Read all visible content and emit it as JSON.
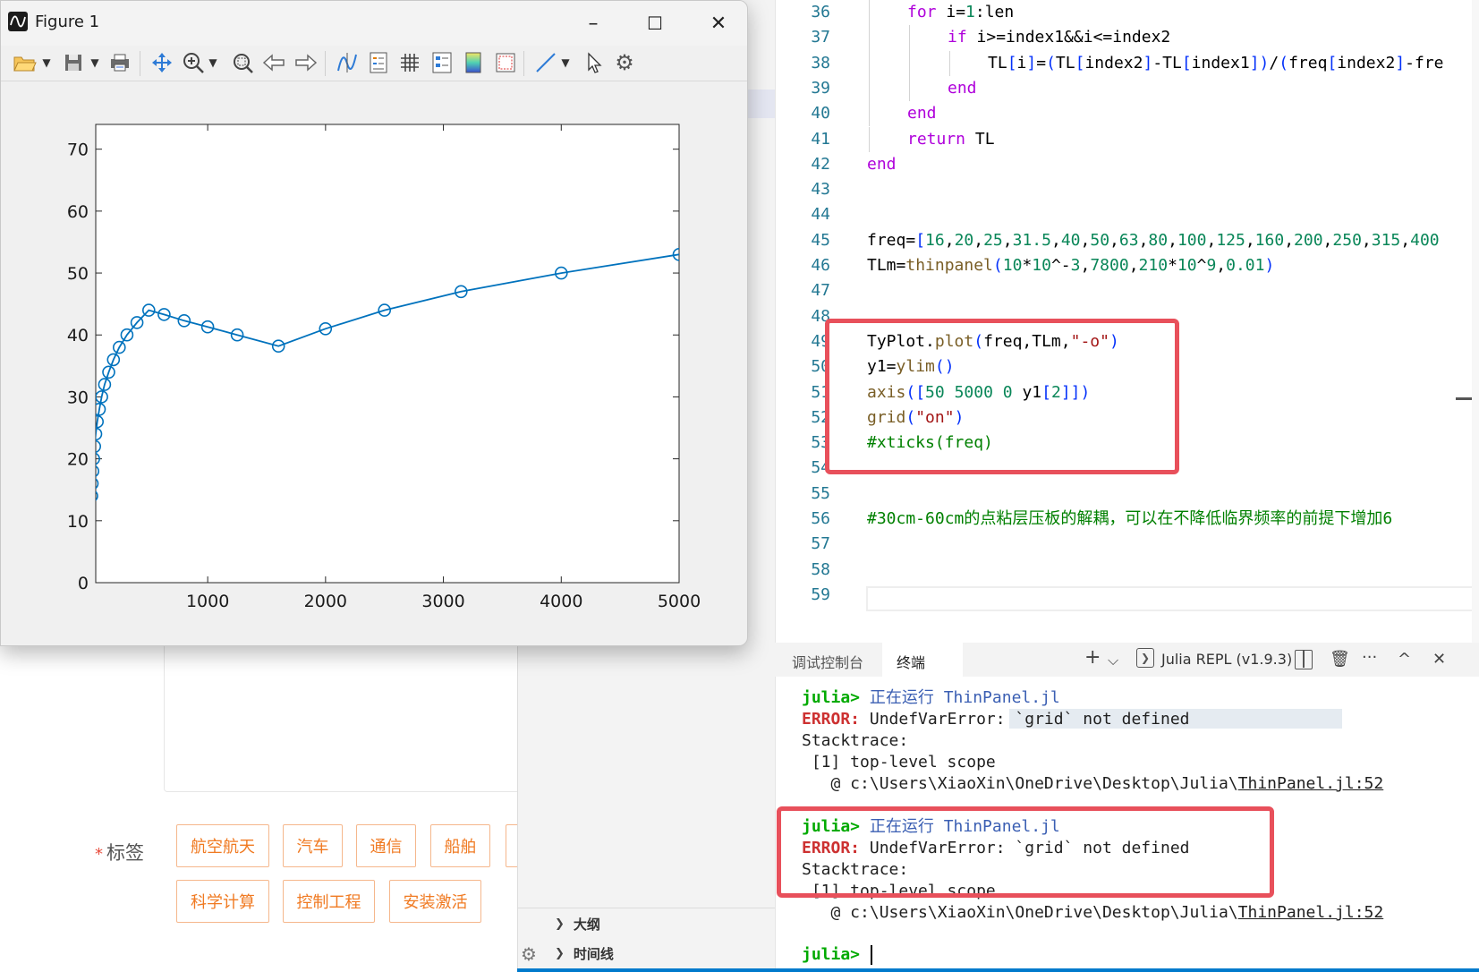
{
  "figure": {
    "title": "Figure 1",
    "window_controls": {
      "minimize": "–",
      "maximize": "☐",
      "close": "✕"
    },
    "chart_data": {
      "type": "line",
      "x": [
        16,
        20,
        25,
        31.5,
        40,
        50,
        63,
        80,
        100,
        125,
        160,
        200,
        250,
        315,
        400,
        500,
        630,
        800,
        1000,
        1250,
        1600,
        2000,
        2500,
        3150,
        4000,
        5000
      ],
      "series": [
        {
          "values": [
            14,
            16,
            18,
            20,
            22,
            24,
            26,
            28,
            30,
            32,
            34,
            36,
            38,
            40,
            42,
            44,
            43.3,
            42.3,
            41.3,
            40,
            38.2,
            41,
            44,
            47,
            50,
            53
          ],
          "marker": "o",
          "color": "#0072bd"
        }
      ],
      "xlim": [
        50,
        5000
      ],
      "ylim": [
        0,
        74
      ],
      "xticks": [
        1000,
        2000,
        3000,
        4000,
        5000
      ],
      "yticks": [
        0,
        10,
        20,
        30,
        40,
        50,
        60,
        70
      ],
      "grid": false,
      "title": "",
      "xlabel": "",
      "ylabel": ""
    }
  },
  "editor": {
    "lines": [
      {
        "n": "36",
        "indent": 2,
        "tokens": [
          [
            "kw",
            "for"
          ],
          [
            "plain",
            " i="
          ],
          [
            "num",
            "1"
          ],
          [
            "plain",
            ":len"
          ]
        ]
      },
      {
        "n": "37",
        "indent": 3,
        "tokens": [
          [
            "kw",
            "if"
          ],
          [
            "plain",
            " i>=index1&&i<=index2"
          ]
        ]
      },
      {
        "n": "38",
        "indent": 4,
        "tokens": [
          [
            "plain",
            "TL"
          ],
          [
            "pun",
            "["
          ],
          [
            "plain",
            "i"
          ],
          [
            "pun",
            "]"
          ],
          [
            "plain",
            "="
          ],
          [
            "pun",
            "("
          ],
          [
            "plain",
            "TL"
          ],
          [
            "pun",
            "["
          ],
          [
            "plain",
            "index2"
          ],
          [
            "pun",
            "]"
          ],
          [
            "plain",
            "-TL"
          ],
          [
            "pun",
            "["
          ],
          [
            "plain",
            "index1"
          ],
          [
            "pun",
            "])"
          ],
          [
            "plain",
            "/"
          ],
          [
            "pun",
            "("
          ],
          [
            "plain",
            "freq"
          ],
          [
            "pun",
            "["
          ],
          [
            "plain",
            "index2"
          ],
          [
            "pun",
            "]"
          ],
          [
            "plain",
            "-fre"
          ]
        ]
      },
      {
        "n": "39",
        "indent": 3,
        "tokens": [
          [
            "kw",
            "end"
          ]
        ]
      },
      {
        "n": "40",
        "indent": 2,
        "tokens": [
          [
            "kw",
            "end"
          ]
        ]
      },
      {
        "n": "41",
        "indent": 2,
        "tokens": [
          [
            "kw",
            "return"
          ],
          [
            "plain",
            " TL"
          ]
        ]
      },
      {
        "n": "42",
        "indent": 1,
        "tokens": [
          [
            "kw",
            "end"
          ]
        ]
      },
      {
        "n": "43",
        "indent": 1,
        "tokens": []
      },
      {
        "n": "44",
        "indent": 1,
        "tokens": []
      },
      {
        "n": "45",
        "indent": 1,
        "tokens": [
          [
            "plain",
            "freq="
          ],
          [
            "pun",
            "["
          ],
          [
            "num",
            "16"
          ],
          [
            "plain",
            ","
          ],
          [
            "num",
            "20"
          ],
          [
            "plain",
            ","
          ],
          [
            "num",
            "25"
          ],
          [
            "plain",
            ","
          ],
          [
            "num",
            "31.5"
          ],
          [
            "plain",
            ","
          ],
          [
            "num",
            "40"
          ],
          [
            "plain",
            ","
          ],
          [
            "num",
            "50"
          ],
          [
            "plain",
            ","
          ],
          [
            "num",
            "63"
          ],
          [
            "plain",
            ","
          ],
          [
            "num",
            "80"
          ],
          [
            "plain",
            ","
          ],
          [
            "num",
            "100"
          ],
          [
            "plain",
            ","
          ],
          [
            "num",
            "125"
          ],
          [
            "plain",
            ","
          ],
          [
            "num",
            "160"
          ],
          [
            "plain",
            ","
          ],
          [
            "num",
            "200"
          ],
          [
            "plain",
            ","
          ],
          [
            "num",
            "250"
          ],
          [
            "plain",
            ","
          ],
          [
            "num",
            "315"
          ],
          [
            "plain",
            ","
          ],
          [
            "num",
            "400"
          ]
        ]
      },
      {
        "n": "46",
        "indent": 1,
        "tokens": [
          [
            "plain",
            "TLm="
          ],
          [
            "fn",
            "thinpanel"
          ],
          [
            "pun",
            "("
          ],
          [
            "num",
            "10"
          ],
          [
            "plain",
            "*"
          ],
          [
            "num",
            "10"
          ],
          [
            "plain",
            "^-"
          ],
          [
            "num",
            "3"
          ],
          [
            "plain",
            ","
          ],
          [
            "num",
            "7800"
          ],
          [
            "plain",
            ","
          ],
          [
            "num",
            "210"
          ],
          [
            "plain",
            "*"
          ],
          [
            "num",
            "10"
          ],
          [
            "plain",
            "^"
          ],
          [
            "num",
            "9"
          ],
          [
            "plain",
            ","
          ],
          [
            "num",
            "0.01"
          ],
          [
            "pun",
            ")"
          ]
        ]
      },
      {
        "n": "47",
        "indent": 1,
        "tokens": []
      },
      {
        "n": "48",
        "indent": 1,
        "tokens": []
      },
      {
        "n": "49",
        "indent": 1,
        "tokens": [
          [
            "plain",
            "TyPlot."
          ],
          [
            "fn",
            "plot"
          ],
          [
            "pun",
            "("
          ],
          [
            "plain",
            "freq,TLm,"
          ],
          [
            "str",
            "\"-o\""
          ],
          [
            "pun",
            ")"
          ]
        ]
      },
      {
        "n": "50",
        "indent": 1,
        "tokens": [
          [
            "plain",
            "y1="
          ],
          [
            "fn",
            "ylim"
          ],
          [
            "pun",
            "()"
          ]
        ]
      },
      {
        "n": "51",
        "indent": 1,
        "tokens": [
          [
            "fn",
            "axis"
          ],
          [
            "pun",
            "(["
          ],
          [
            "num",
            "50"
          ],
          [
            "plain",
            " "
          ],
          [
            "num",
            "5000"
          ],
          [
            "plain",
            " "
          ],
          [
            "num",
            "0"
          ],
          [
            "plain",
            " y1"
          ],
          [
            "pun",
            "["
          ],
          [
            "num",
            "2"
          ],
          [
            "pun",
            "]])"
          ]
        ]
      },
      {
        "n": "52",
        "indent": 1,
        "tokens": [
          [
            "fn",
            "grid"
          ],
          [
            "pun",
            "("
          ],
          [
            "str",
            "\"on\""
          ],
          [
            "pun",
            ")"
          ]
        ]
      },
      {
        "n": "53",
        "indent": 1,
        "tokens": [
          [
            "cmt",
            "#xticks(freq)"
          ]
        ]
      },
      {
        "n": "54",
        "indent": 1,
        "tokens": []
      },
      {
        "n": "55",
        "indent": 1,
        "tokens": []
      },
      {
        "n": "56",
        "indent": 1,
        "tokens": [
          [
            "cmt",
            "#30cm-60cm的点粘层压板的解耦，可以在不降低临界频率的前提下增加6"
          ]
        ]
      },
      {
        "n": "57",
        "indent": 1,
        "tokens": []
      },
      {
        "n": "58",
        "indent": 1,
        "tokens": []
      },
      {
        "n": "59",
        "indent": 1,
        "tokens": []
      }
    ]
  },
  "panel": {
    "tabs": [
      "调试控制台",
      "终端"
    ],
    "active_tab": "终端",
    "terminal_name": "Julia REPL (v1.9.3)",
    "icons": {
      "add": "+",
      "dropdown": "⌵",
      "split": "◫",
      "trash": "🗑",
      "more": "···",
      "maximize": "^",
      "close": "✕"
    },
    "blocks": [
      {
        "prompt": "julia>",
        "running": "正在运行",
        "file": "ThinPanel.jl",
        "error_label": "ERROR:",
        "error_msg": "UndefVarError: `grid` not defined",
        "stacktrace": "Stacktrace:",
        "frame": " [1] top-level scope",
        "at": "   @ c:\\Users\\XiaoXin\\OneDrive\\Desktop\\Julia\\",
        "at_file": "ThinPanel.jl:52"
      },
      {
        "prompt": "julia>",
        "running": "正在运行",
        "file": "ThinPanel.jl",
        "error_label": "ERROR:",
        "error_msg": "UndefVarError: `grid` not defined",
        "stacktrace": "Stacktrace:",
        "frame": " [1] top-level scope",
        "at": "   @ c:\\Users\\XiaoXin\\OneDrive\\Desktop\\Julia\\",
        "at_file": "ThinPanel.jl:52"
      }
    ],
    "final_prompt": "julia>"
  },
  "sidebar": {
    "sections": [
      "大纲",
      "时间线"
    ]
  },
  "webform": {
    "required_mark": "*",
    "tags_label": "标签",
    "tags_row1": [
      "航空航天",
      "汽车",
      "通信",
      "船舶"
    ],
    "tags_row2": [
      "科学计算",
      "控制工程",
      "安装激活"
    ]
  }
}
